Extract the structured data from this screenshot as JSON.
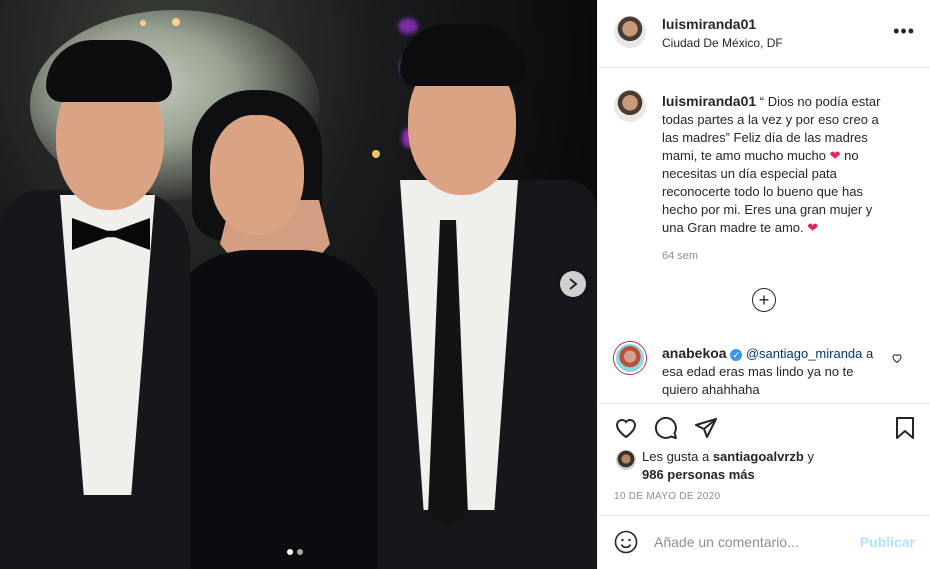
{
  "header": {
    "username": "luismiranda01",
    "location": "Ciudad De México, DF",
    "more_icon": "more-horizontal-icon"
  },
  "photo": {
    "carousel": {
      "total_slides": 2,
      "active_slide": 1
    },
    "next_icon": "chevron-right-icon"
  },
  "caption": {
    "username": "luismiranda01",
    "lines": [
      "“ Dios no podía estar",
      "todas partes a la vez y por eso creo a",
      "las madres” Feliz día de las madres",
      "mami, te amo mucho mucho",
      "no",
      "necesitas un día especial pata",
      "reconocerte todo lo bueno que has",
      "hecho por mi. Eres una gran mujer y",
      "una Gran madre te amo."
    ],
    "time": "64 sem"
  },
  "load_more_icon": "plus-circle-icon",
  "comment": {
    "username": "anabekoa",
    "verified_icon": "verified-badge-icon",
    "mention": "@santiago_miranda",
    "text_1": " a",
    "line_2": "esa edad eras mas lindo ya no te",
    "line_3": "quiero ahahhaha",
    "like_icon": "heart-outline-icon"
  },
  "actions": {
    "icons": [
      "heart-outline-icon",
      "comment-icon",
      "share-icon",
      "bookmark-icon"
    ]
  },
  "likes": {
    "prefix": "Les gusta a ",
    "first_user": "santiagoalvrzb",
    "conjunction": " y",
    "others": "986 personas más"
  },
  "date": "10 DE MAYO DE 2020",
  "composer": {
    "emoji_icon": "emoji-smile-icon",
    "placeholder": "Añade un comentario...",
    "publish_label": "Publicar"
  },
  "colors": {
    "heart": "#e0245e",
    "publish_disabled": "#b2dffc",
    "mention": "#00376b",
    "verified": "#3897f0"
  }
}
